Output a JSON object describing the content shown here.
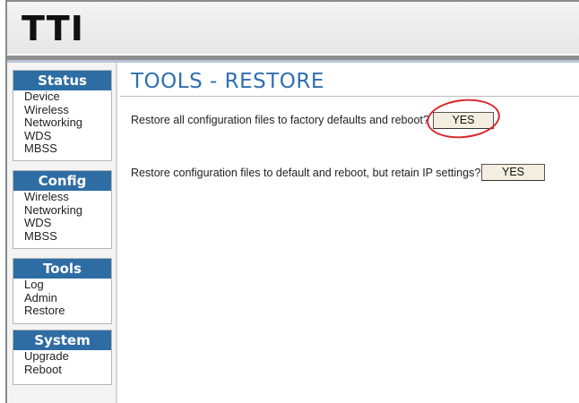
{
  "header": {
    "logo_text": "TTI"
  },
  "sidebar": {
    "sections": [
      {
        "title": "Status",
        "items": [
          "Device",
          "Wireless",
          "Networking",
          "WDS",
          "MBSS"
        ]
      },
      {
        "title": "Config",
        "items": [
          "Wireless",
          "Networking",
          "WDS",
          "MBSS"
        ]
      },
      {
        "title": "Tools",
        "items": [
          "Log",
          "Admin",
          "Restore"
        ]
      },
      {
        "title": "System",
        "items": [
          "Upgrade",
          "Reboot"
        ]
      }
    ]
  },
  "main": {
    "title": "TOOLS - RESTORE",
    "rows": [
      {
        "text": "Restore all configuration files to factory defaults and reboot?",
        "button_label": "YES"
      },
      {
        "text": "Restore configuration files to default and reboot, but retain IP settings?",
        "button_label": "YES"
      }
    ]
  },
  "colors": {
    "accent": "#2e6da4",
    "title": "#2f6fb0",
    "highlight": "#d9262d"
  }
}
